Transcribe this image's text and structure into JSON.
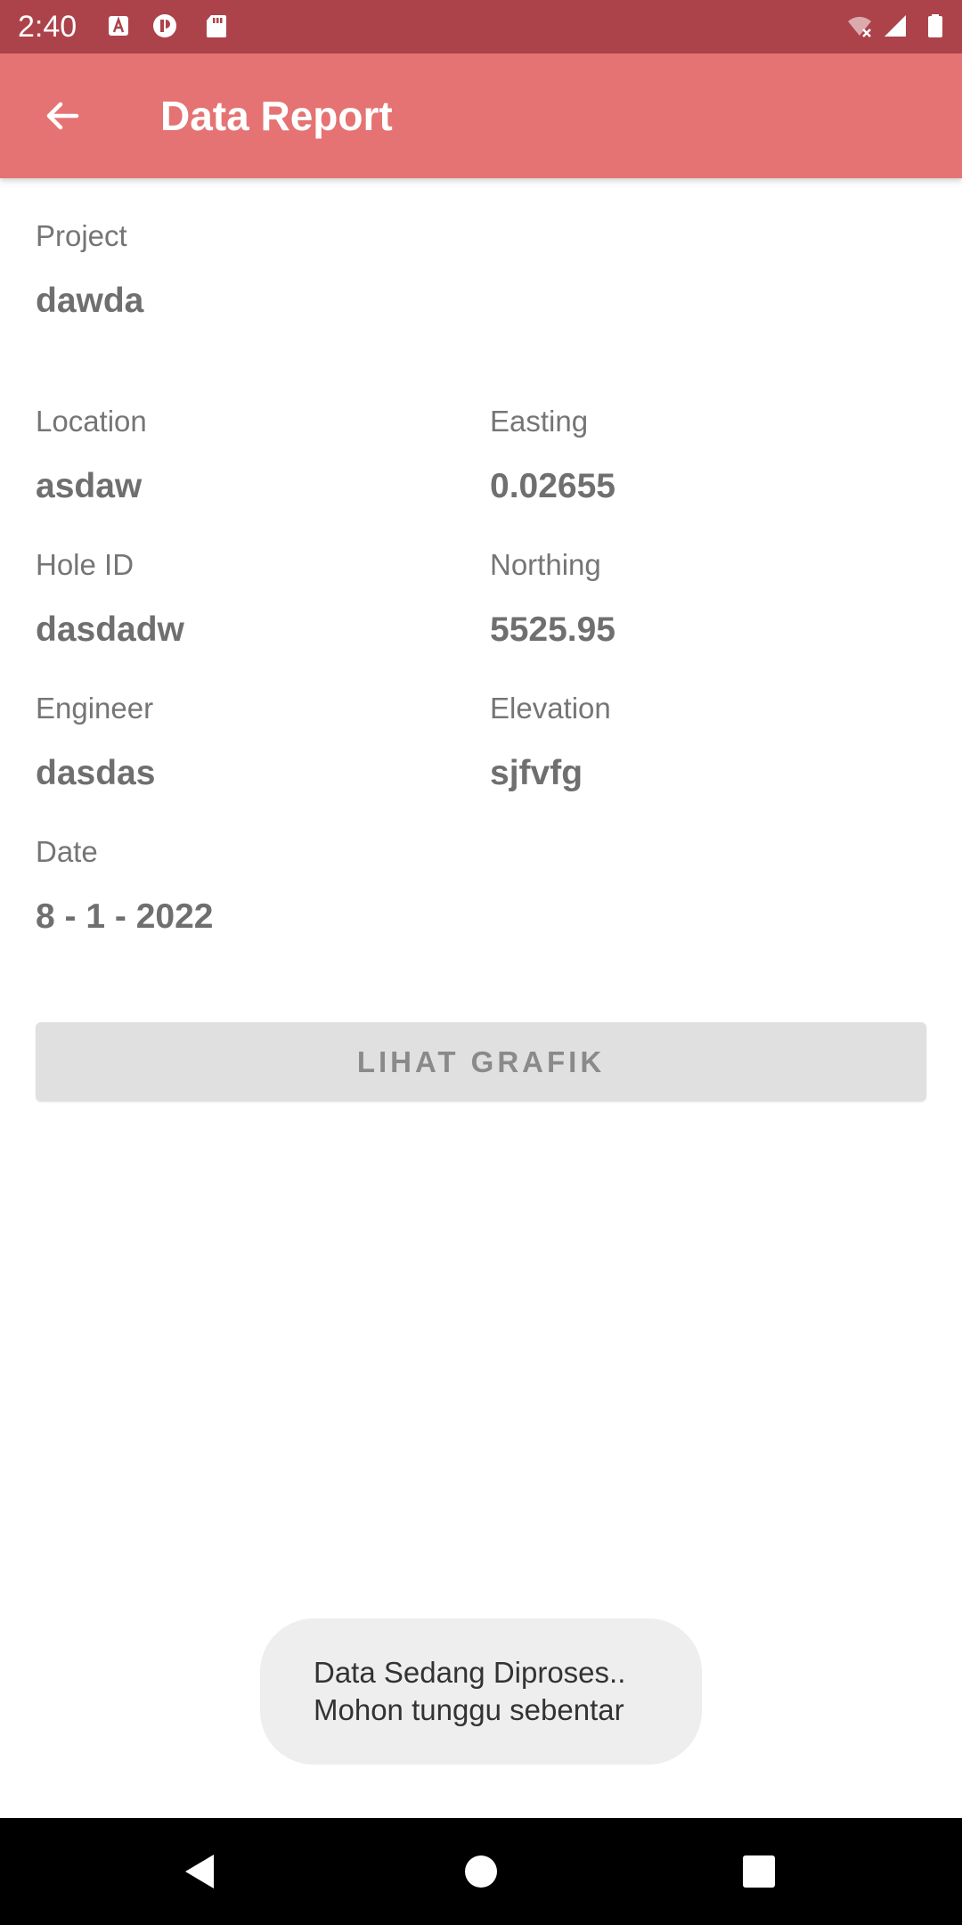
{
  "status_bar": {
    "time": "2:40",
    "icons": [
      "a-notification-icon",
      "app-notification-icon",
      "sd-card-icon",
      "wifi-off-icon",
      "signal-icon",
      "battery-icon"
    ]
  },
  "app_bar": {
    "title": "Data Report",
    "back_icon": "arrow-back-icon",
    "color": "#E57373"
  },
  "fields": {
    "project": {
      "label": "Project",
      "value": "dawda"
    },
    "location": {
      "label": "Location",
      "value": "asdaw"
    },
    "easting": {
      "label": "Easting",
      "value": "0.02655"
    },
    "hole_id": {
      "label": "Hole ID",
      "value": "dasdadw"
    },
    "northing": {
      "label": "Northing",
      "value": "5525.95"
    },
    "engineer": {
      "label": "Engineer",
      "value": "dasdas"
    },
    "elevation": {
      "label": "Elevation",
      "value": "sjfvfg"
    },
    "date": {
      "label": "Date",
      "value": "8 - 1 - 2022"
    }
  },
  "chart_button": {
    "label": "LIHAT GRAFIK"
  },
  "toast": {
    "line1": "Data Sedang Diproses..",
    "line2": "Mohon tunggu sebentar"
  },
  "nav_bar": {
    "icons": [
      "back-triangle-icon",
      "home-circle-icon",
      "recents-square-icon"
    ]
  }
}
